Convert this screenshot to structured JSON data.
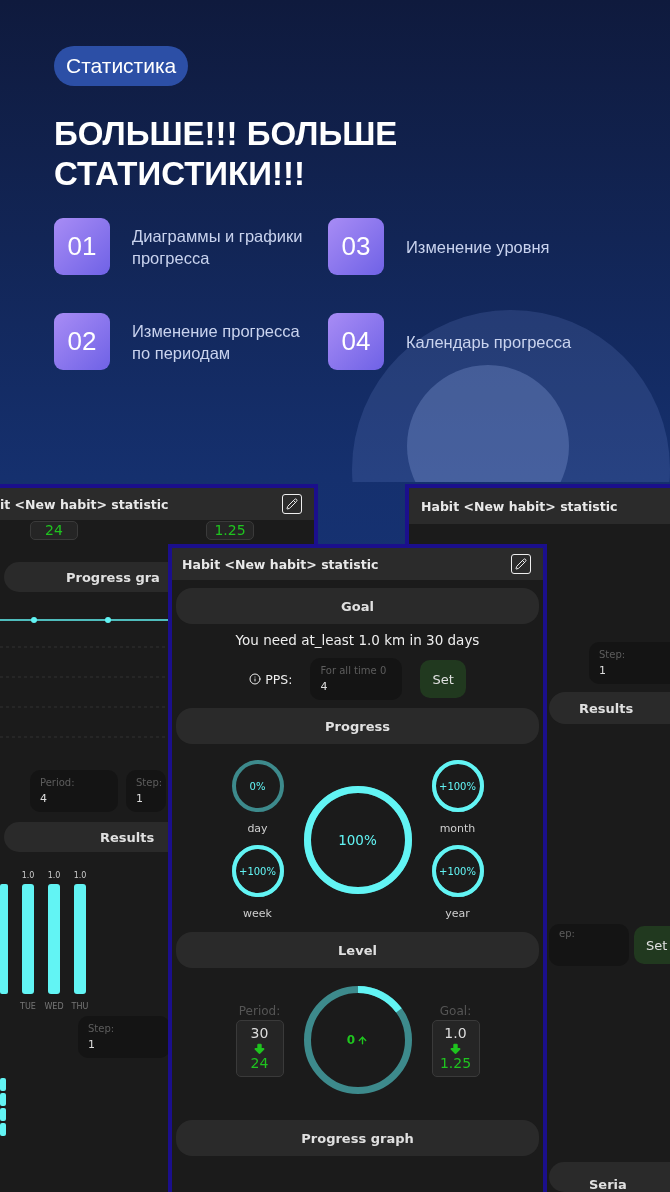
{
  "hero": {
    "tag": "Статистика",
    "title": "БОЛЬШЕ!!! БОЛЬШЕ СТАТИСТИКИ!!!",
    "features": [
      {
        "number": "01",
        "text": "Диаграммы и графики прогресса"
      },
      {
        "number": "03",
        "text": "Изменение уровня"
      },
      {
        "number": "02",
        "text": "Изменение прогресса по периодам"
      },
      {
        "number": "04",
        "text": "Календарь прогресса"
      }
    ]
  },
  "left_screen": {
    "title": "it <New habit> statistic",
    "top_values": [
      "24",
      "1.25"
    ],
    "graph_heading": "Progress gra",
    "period": {
      "label": "Period:",
      "value": "4"
    },
    "step": {
      "label": "Step:",
      "value": "1"
    },
    "results_heading": "Results",
    "chart_data": {
      "type": "bar",
      "categories": [
        "TUE",
        "WED",
        "THU"
      ],
      "values": [
        1.0,
        1.0,
        1.0
      ],
      "data_labels": true,
      "value_labels": [
        "1.0",
        "1.0",
        "1.0"
      ]
    },
    "step2": {
      "label": "Step:",
      "value": "1"
    }
  },
  "right_screen": {
    "title": "Habit <New habit> statistic",
    "step": {
      "label": "Step:",
      "value": "1"
    },
    "results_heading": "Results",
    "step2": {
      "label": "ep:"
    },
    "set_button": "Set",
    "bottom_heading": "Seria"
  },
  "main_screen": {
    "title": "Habit <New habit> statistic",
    "goal": {
      "heading": "Goal",
      "text": "You need at_least 1.0 km in 30 days",
      "pps_label": "PPS:",
      "pps_field": {
        "label": "For all time 0",
        "value": "4"
      },
      "set_button": "Set"
    },
    "progress": {
      "heading": "Progress",
      "rings": [
        {
          "value": "0%",
          "label": "day",
          "filled": false
        },
        {
          "value": "+100%",
          "label": "month",
          "filled": true
        },
        {
          "value": "+100%",
          "label": "week",
          "filled": true
        },
        {
          "value": "+100%",
          "label": "year",
          "filled": true
        }
      ],
      "total": {
        "value": "100%",
        "filled": true
      }
    },
    "level": {
      "heading": "Level",
      "period": {
        "label": "Period:",
        "from": "30",
        "to": "24"
      },
      "ring": {
        "value": "0",
        "level": 0.15
      },
      "goal": {
        "label": "Goal:",
        "from": "1.0",
        "to": "1.25"
      }
    },
    "graph_heading": "Progress graph"
  }
}
